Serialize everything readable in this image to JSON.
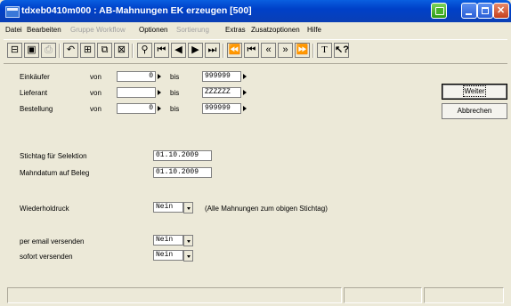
{
  "window": {
    "title": "tdxeb0410m000 : AB-Mahnungen EK erzeugen [500]"
  },
  "menu": {
    "items": [
      {
        "label": "Datei",
        "enabled": true
      },
      {
        "label": "Bearbeiten",
        "enabled": true
      },
      {
        "label": "Gruppe",
        "enabled": false
      },
      {
        "label": "Workflow",
        "enabled": false
      },
      {
        "label": "Optionen",
        "enabled": true
      },
      {
        "label": "Sortierung",
        "enabled": false
      },
      {
        "label": "Extras",
        "enabled": true
      },
      {
        "label": "Zusatzoptionen",
        "enabled": true
      },
      {
        "label": "Hilfe",
        "enabled": true
      }
    ]
  },
  "toolbar": {
    "icons": [
      "exit-icon",
      "save-icon",
      "print-icon",
      "undo-icon",
      "insert-record-icon",
      "copy-record-icon",
      "delete-record-icon",
      "find-icon",
      "first-record-icon",
      "previous-record-icon",
      "next-record-icon",
      "last-record-icon",
      "first-set-icon",
      "previous-set-icon",
      "previous-page-icon",
      "next-page-icon",
      "next-set-icon",
      "text-icon",
      "context-help-icon"
    ]
  },
  "form": {
    "range_from_label": "von",
    "range_to_label": "bis",
    "ranges": [
      {
        "label": "Einkäufer",
        "from": "0",
        "to": "999999"
      },
      {
        "label": "Lieferant",
        "from": "",
        "to": "ZZZZZZ"
      },
      {
        "label": "Bestellung",
        "from": "0",
        "to": "999999"
      }
    ],
    "stichtag_label": "Stichtag für Selektion",
    "stichtag_value": "01.10.2009",
    "mahndatum_label": "Mahndatum auf Beleg",
    "mahndatum_value": "01.10.2009",
    "wiederholdruck_label": "Wiederholdruck",
    "wiederholdruck_value": "Nein",
    "wiederholdruck_hint": "(Alle Mahnungen zum obigen Stichtag)",
    "email_label": "per email versenden",
    "email_value": "Nein",
    "sofort_label": "sofort versenden",
    "sofort_value": "Nein"
  },
  "buttons": {
    "weiter": "Weiter",
    "abbrechen": "Abbrechen"
  }
}
